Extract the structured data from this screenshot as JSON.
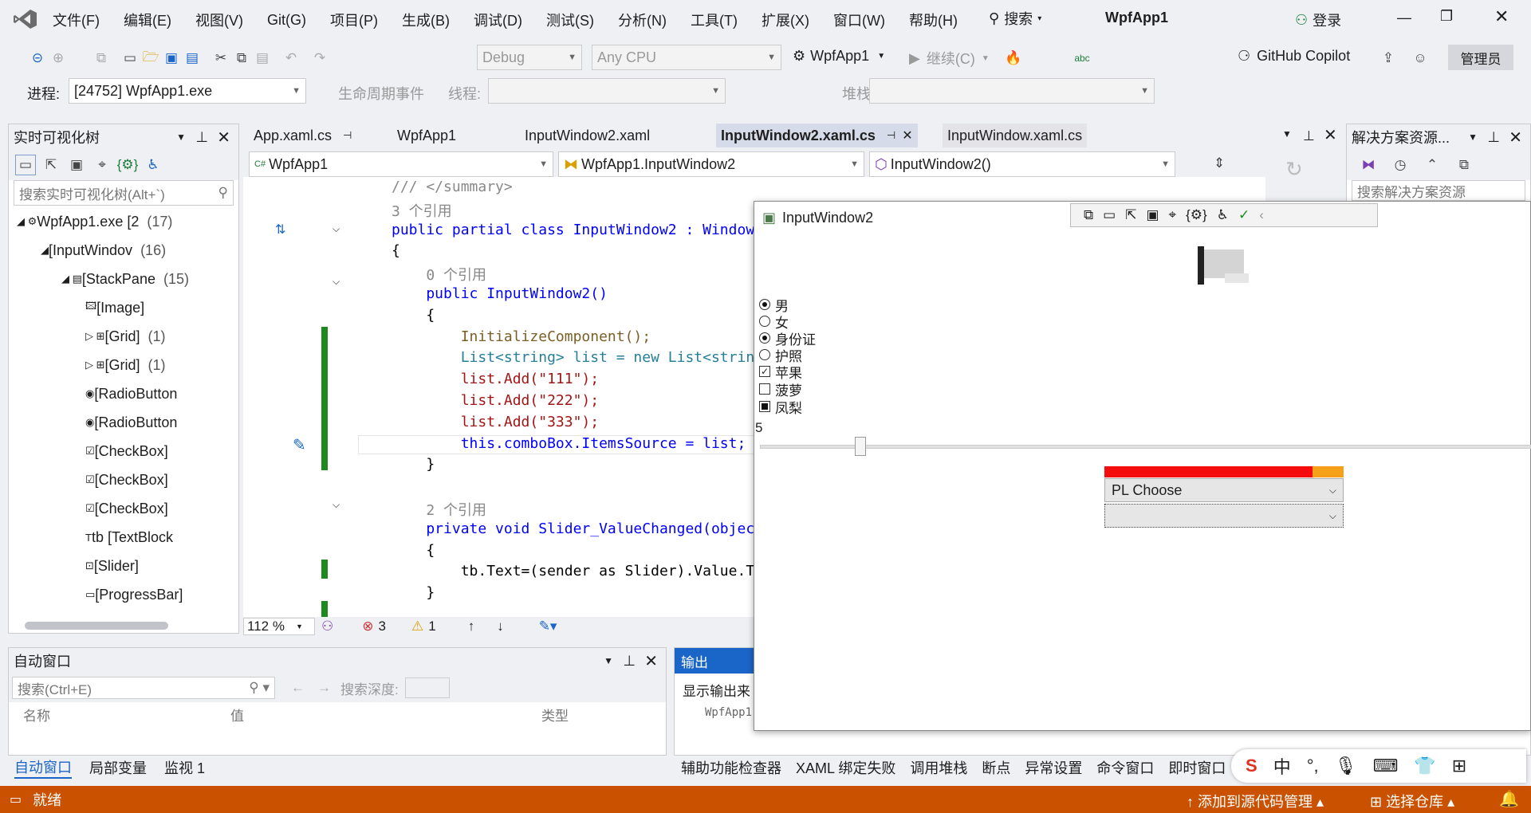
{
  "menu": [
    "文件(F)",
    "编辑(E)",
    "视图(V)",
    "Git(G)",
    "项目(P)",
    "生成(B)",
    "调试(D)",
    "测试(S)",
    "分析(N)",
    "工具(T)",
    "扩展(X)",
    "窗口(W)",
    "帮助(H)"
  ],
  "search_label": "搜索",
  "app_title": "WpfApp1",
  "login": "登录",
  "config": "Debug",
  "platform": "Any CPU",
  "startup": "WpfApp1",
  "continue": "继续(C)",
  "copilot": "GitHub Copilot",
  "admin": "管理员",
  "process_label": "进程:",
  "process_value": "[24752] WpfApp1.exe",
  "lifecycle": "生命周期事件",
  "thread": "线程:",
  "stackframe": "堆栈帧:",
  "live_tree": {
    "title": "实时可视化树",
    "search": "搜索实时可视化树(Alt+`)",
    "rows": [
      {
        "t": "WpfApp1.exe [2",
        "c": "(17)"
      },
      {
        "t": "[InputWindov",
        "c": "(16)"
      },
      {
        "t": "[StackPane",
        "c": "(15)"
      },
      {
        "t": "[Image]",
        "c": ""
      },
      {
        "t": "[Grid]",
        "c": "(1)"
      },
      {
        "t": "[Grid]",
        "c": "(1)"
      },
      {
        "t": "[RadioButton",
        "c": ""
      },
      {
        "t": "[RadioButton",
        "c": ""
      },
      {
        "t": "[CheckBox]",
        "c": ""
      },
      {
        "t": "[CheckBox]",
        "c": ""
      },
      {
        "t": "[CheckBox]",
        "c": ""
      },
      {
        "t": "tb [TextBlock",
        "c": ""
      },
      {
        "t": "[Slider]",
        "c": ""
      },
      {
        "t": "[ProgressBar]",
        "c": ""
      }
    ]
  },
  "tabs": [
    "App.xaml.cs",
    "WpfApp1",
    "InputWindow2.xaml",
    "InputWindow2.xaml.cs",
    "InputWindow.xaml.cs"
  ],
  "nav": [
    "WpfApp1",
    "WpfApp1.InputWindow2",
    "InputWindow2()"
  ],
  "code": [
    "/// </summary>",
    "3 个引用",
    "public partial class InputWindow2 : Window",
    "{",
    "    0 个引用",
    "    public InputWindow2()",
    "    {",
    "        InitializeComponent();",
    "        List<string> list = new List<string>",
    "        list.Add(\"111\");",
    "        list.Add(\"222\");",
    "        list.Add(\"333\");",
    "        this.comboBox.ItemsSource = list;",
    "    }",
    "",
    "    2 个引用",
    "    private void Slider_ValueChanged(objec",
    "    {",
    "        tb.Text=(sender as Slider).Value.T",
    "    }"
  ],
  "editor_status": {
    "zoom": "112 %",
    "errors": "3",
    "warnings": "1"
  },
  "solution_title": "解决方案资源...",
  "solution_search": "搜索解决方案资源",
  "auto_window": {
    "title": "自动窗口",
    "search": "搜索(Ctrl+E)",
    "depth": "搜索深度:",
    "cols": [
      "名称",
      "值",
      "类型"
    ]
  },
  "bottom_tabs": [
    "自动窗口",
    "局部变量",
    "监视 1"
  ],
  "output": {
    "title": "输出",
    "show": "显示输出来",
    "line": "WpfApp1"
  },
  "tool_tabs": [
    "辅助功能检查器",
    "XAML 绑定失败",
    "调用堆栈",
    "断点",
    "异常设置",
    "命令窗口",
    "即时窗口"
  ],
  "status": {
    "ready": "就绪",
    "source": "添加到源代码管理",
    "repo": "选择仓库"
  },
  "ime": [
    "中",
    "°,"
  ],
  "wpf": {
    "title": "InputWindow2",
    "radios": [
      {
        "l": "男",
        "on": true
      },
      {
        "l": "女",
        "on": false
      },
      {
        "l": "身份证",
        "on": true
      },
      {
        "l": "护照",
        "on": false
      }
    ],
    "checks": [
      {
        "l": "苹果",
        "s": "checked"
      },
      {
        "l": "菠萝",
        "s": "unchecked"
      },
      {
        "l": "凤梨",
        "s": "indeterminate"
      }
    ],
    "tb": "5",
    "slider": 0.13,
    "progress": 0.87,
    "combo": "PL Choose"
  }
}
